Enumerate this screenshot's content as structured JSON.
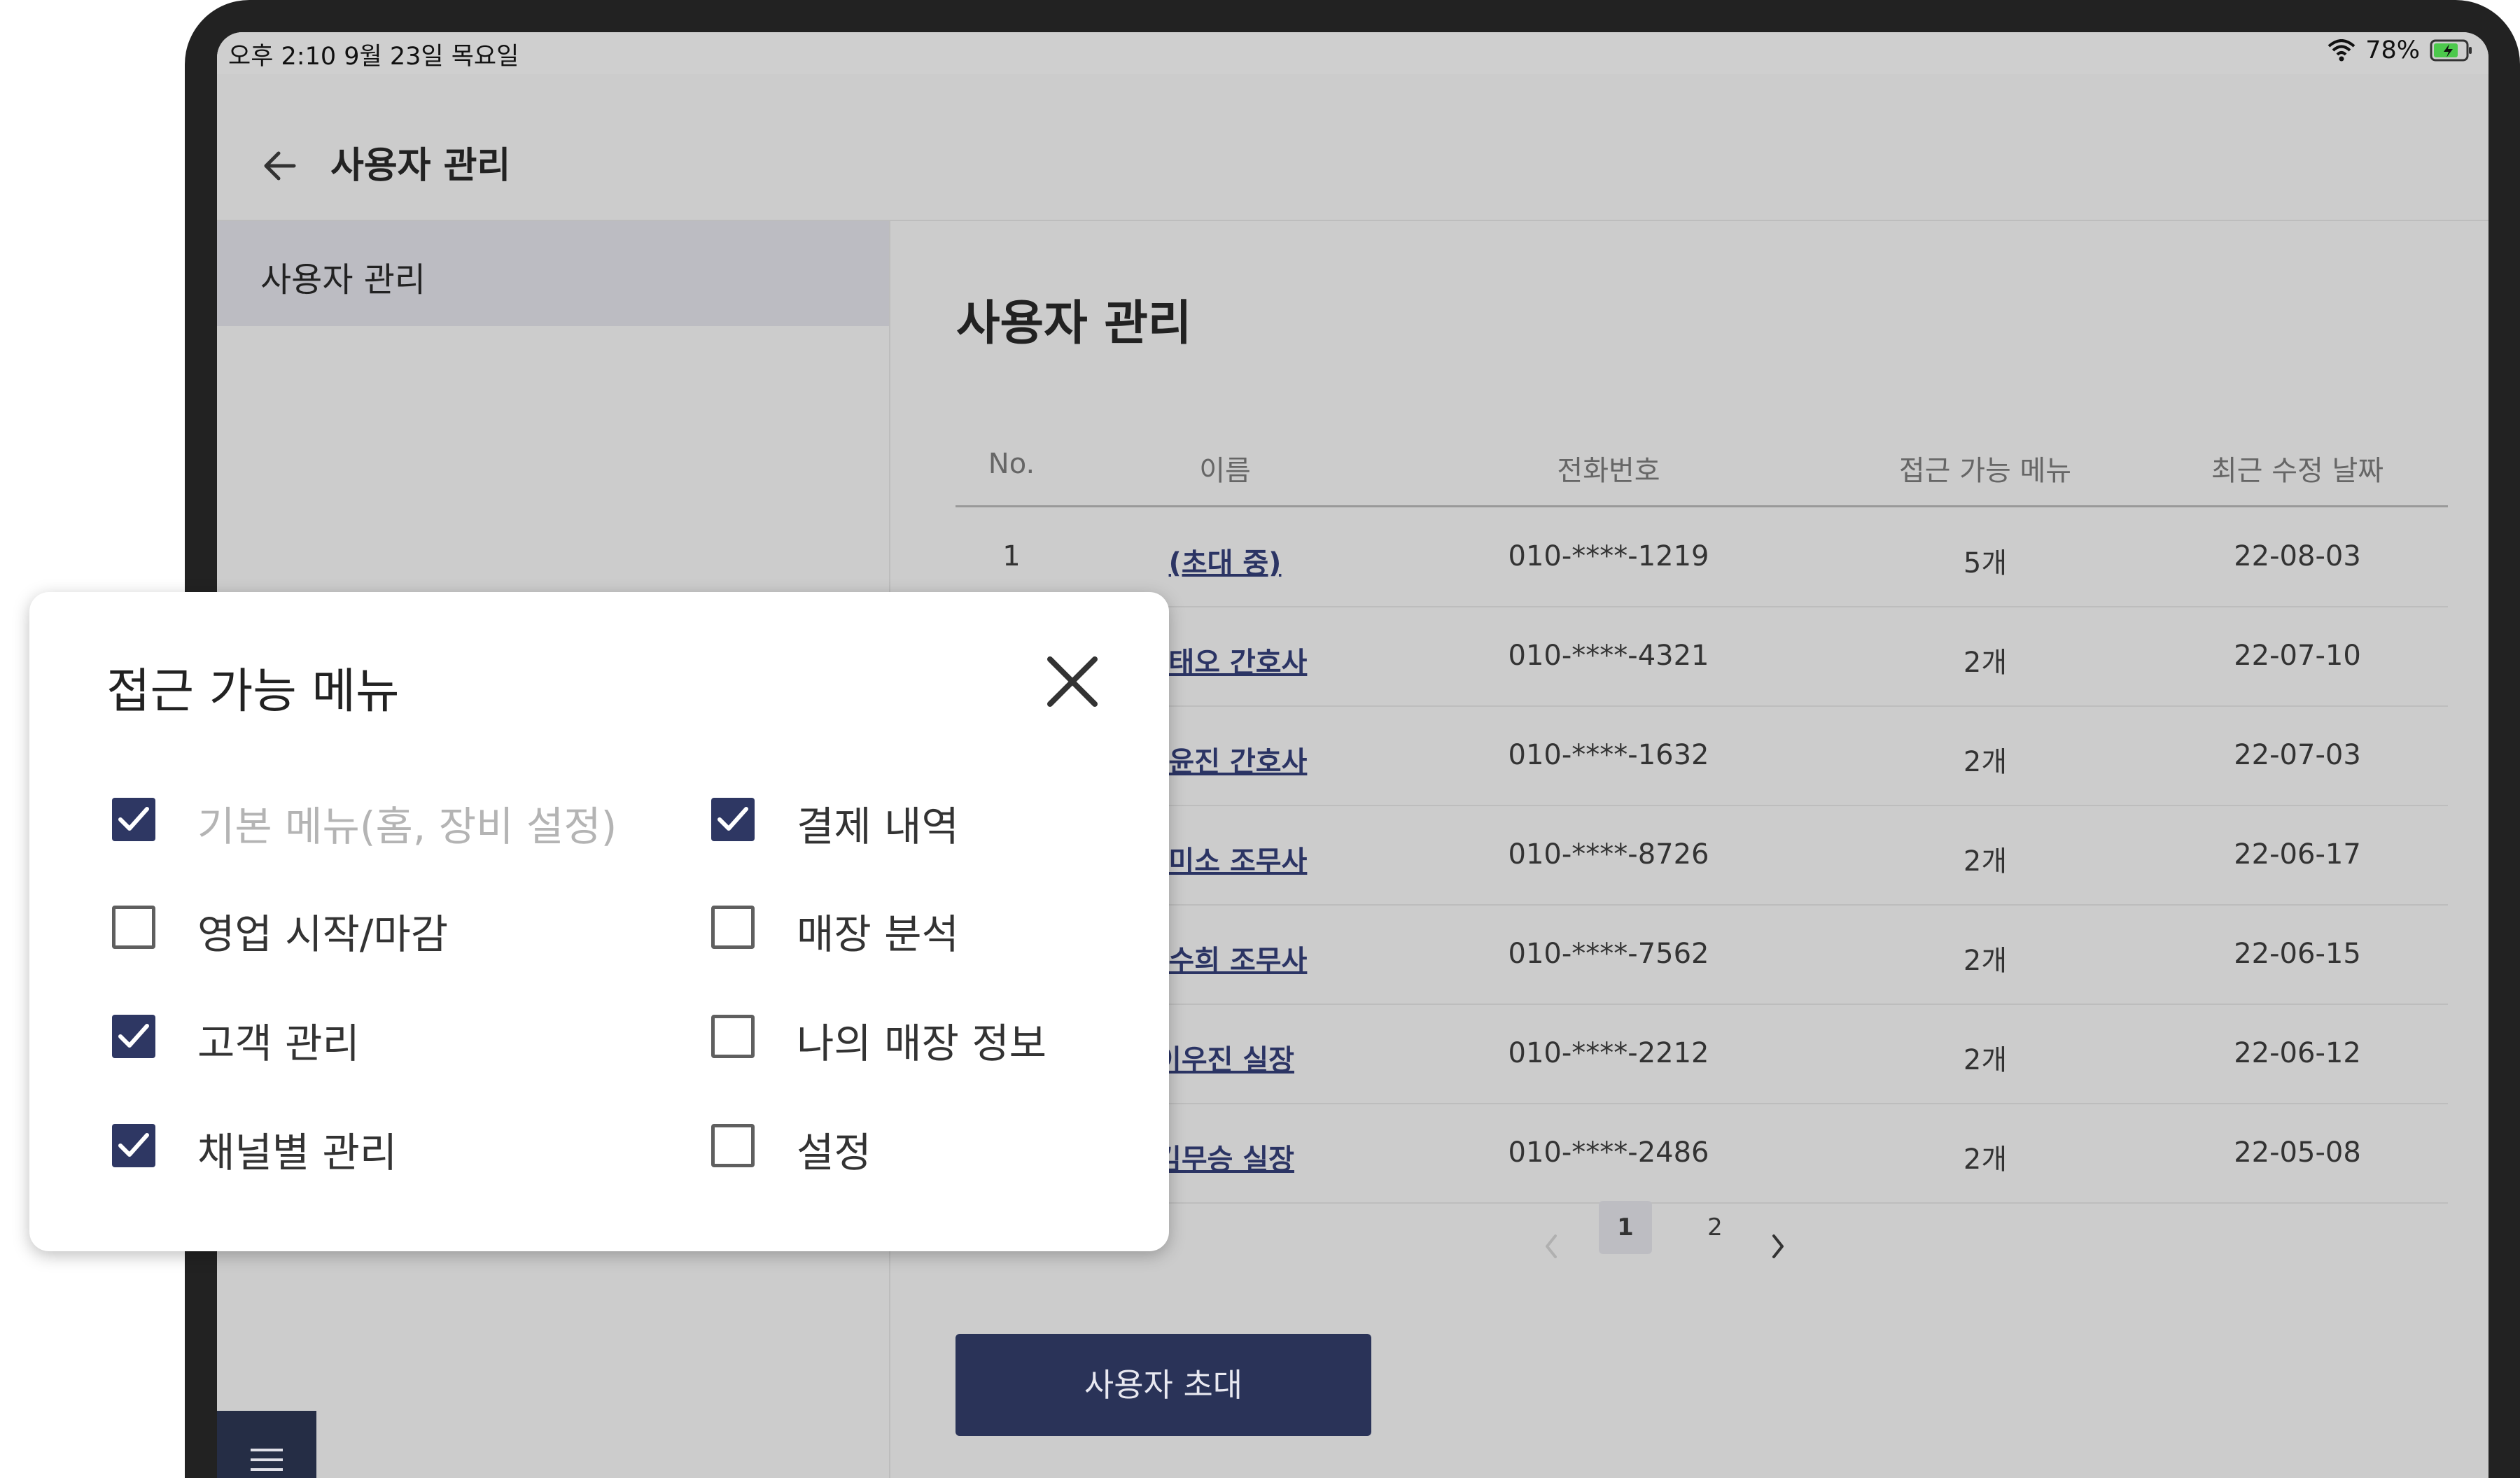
{
  "status_bar": {
    "time": "오후 2:10   9월 23일 목요일",
    "battery": "78%"
  },
  "header": {
    "title": "사용자 관리"
  },
  "sidebar": {
    "items": [
      {
        "label": "사용자 관리"
      }
    ]
  },
  "main": {
    "title": "사용자 관리",
    "table": {
      "headers": [
        "No.",
        "이름",
        "전화번호",
        "접근 가능 메뉴",
        "최근 수정 날짜"
      ],
      "rows": [
        {
          "no": "1",
          "name": "(초대 중)",
          "phone": "010-****-1219",
          "menus": "5개",
          "date": "22-08-03"
        },
        {
          "no": "",
          "name": "유태오 간호사",
          "phone": "010-****-4321",
          "menus": "2개",
          "date": "22-07-10"
        },
        {
          "no": "",
          "name": "김윤진 간호사",
          "phone": "010-****-1632",
          "menus": "2개",
          "date": "22-07-03"
        },
        {
          "no": "",
          "name": "이미소 조무사",
          "phone": "010-****-8726",
          "menus": "2개",
          "date": "22-06-17"
        },
        {
          "no": "",
          "name": "강수희 조무사",
          "phone": "010-****-7562",
          "menus": "2개",
          "date": "22-06-15"
        },
        {
          "no": "",
          "name": "이우진 실장",
          "phone": "010-****-2212",
          "menus": "2개",
          "date": "22-06-12"
        },
        {
          "no": "",
          "name": "김무승 실장",
          "phone": "010-****-2486",
          "menus": "2개",
          "date": "22-05-08"
        }
      ]
    },
    "pagination": {
      "current": "1",
      "next_page": "2"
    },
    "invite_button": "사용자 초대"
  },
  "modal": {
    "title": "접근 가능 메뉴",
    "options": [
      {
        "label": "기본 메뉴(홈, 장비 설정)",
        "checked": true,
        "disabled": true
      },
      {
        "label": "결제 내역",
        "checked": true,
        "disabled": false
      },
      {
        "label": "영업 시작/마감",
        "checked": false,
        "disabled": false
      },
      {
        "label": "매장 분석",
        "checked": false,
        "disabled": false
      },
      {
        "label": "고객 관리",
        "checked": true,
        "disabled": false
      },
      {
        "label": "나의 매장 정보",
        "checked": false,
        "disabled": false
      },
      {
        "label": "채널별 관리",
        "checked": true,
        "disabled": false
      },
      {
        "label": "설정",
        "checked": false,
        "disabled": false
      }
    ]
  },
  "colors": {
    "accent_navy": "#2e3763",
    "screen_dim": "#cccccc",
    "modal_bg": "#ffffff",
    "link": "#2b3464"
  }
}
